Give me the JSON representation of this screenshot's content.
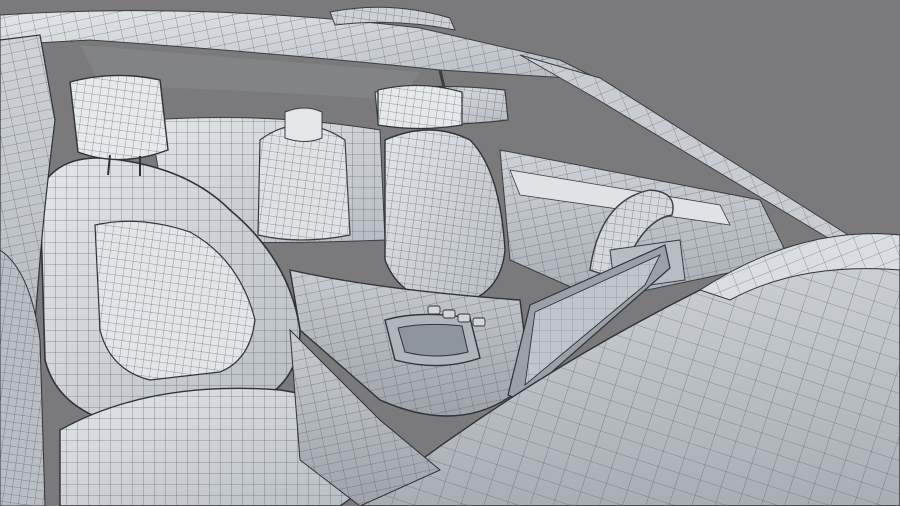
{
  "image": {
    "subject": "car-interior-wireframe-render",
    "colors": {
      "background": "#7a7a7c",
      "surface": "#d9dcdf",
      "surface_shadow": "#aeb3b8",
      "dashboard": "#c4c9ce",
      "wire": "#3a3d42",
      "wire_light": "#6b7077"
    }
  }
}
